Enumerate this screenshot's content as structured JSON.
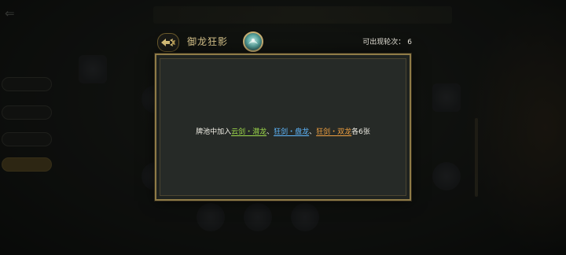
{
  "dialog": {
    "title": "御龙狂影",
    "rounds_label": "可出现轮次：",
    "rounds_value": "6",
    "description": {
      "prefix": "牌池中加入",
      "items": [
        {
          "name": "云剑・潜龙",
          "color": "#9ed94b"
        },
        {
          "name": "狂剑・盘龙",
          "color": "#5fb8ff"
        },
        {
          "name": "狂剑・双龙",
          "color": "#f0a040"
        }
      ],
      "separator": "、",
      "suffix": "各6张"
    }
  },
  "colors": {
    "border_gold": "#8f7b47",
    "title_gold": "#d9c58c",
    "panel_bg": "#262a27"
  },
  "icons": {
    "back": "winged-arrow-back-icon",
    "emblem": "jade-dragon-emblem-icon"
  }
}
